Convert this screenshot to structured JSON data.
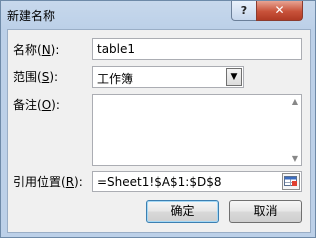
{
  "window": {
    "title": "新建名称",
    "help_label": "?",
    "close_label": "✕"
  },
  "form": {
    "name_label_prefix": "名称(",
    "name_label_key": "N",
    "name_label_suffix": "):",
    "name_value": "table1",
    "scope_label_prefix": "范围(",
    "scope_label_key": "S",
    "scope_label_suffix": "):",
    "scope_value": "工作簿",
    "comment_label_prefix": "备注(",
    "comment_label_key": "O",
    "comment_label_suffix": "):",
    "comment_value": "",
    "refers_label_prefix": "引用位置(",
    "refers_label_key": "R",
    "refers_label_suffix": "):",
    "refers_value": "=Sheet1!$A$1:$D$8"
  },
  "buttons": {
    "ok_label": "确定",
    "cancel_label": "取消"
  },
  "icons": {
    "dropdown": "chevron-down-icon",
    "scroll_up": "scroll-up-icon",
    "scroll_down": "scroll-down-icon",
    "range_select": "range-select-icon"
  }
}
